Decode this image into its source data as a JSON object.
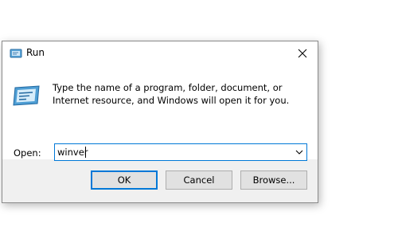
{
  "window": {
    "title": "Run",
    "title_icon": "run-icon",
    "close_icon": "close-icon"
  },
  "main": {
    "icon": "run-large-icon",
    "description": "Type the name of a program, folder, document, or Internet resource, and Windows will open it for you.",
    "open_label": "Open:",
    "input_value": "winver"
  },
  "buttons": {
    "ok": "OK",
    "cancel": "Cancel",
    "browse": "Browse..."
  },
  "colors": {
    "accent": "#0078d7",
    "dialog_bg": "#f0f0f0",
    "button_bg": "#e1e1e1"
  }
}
